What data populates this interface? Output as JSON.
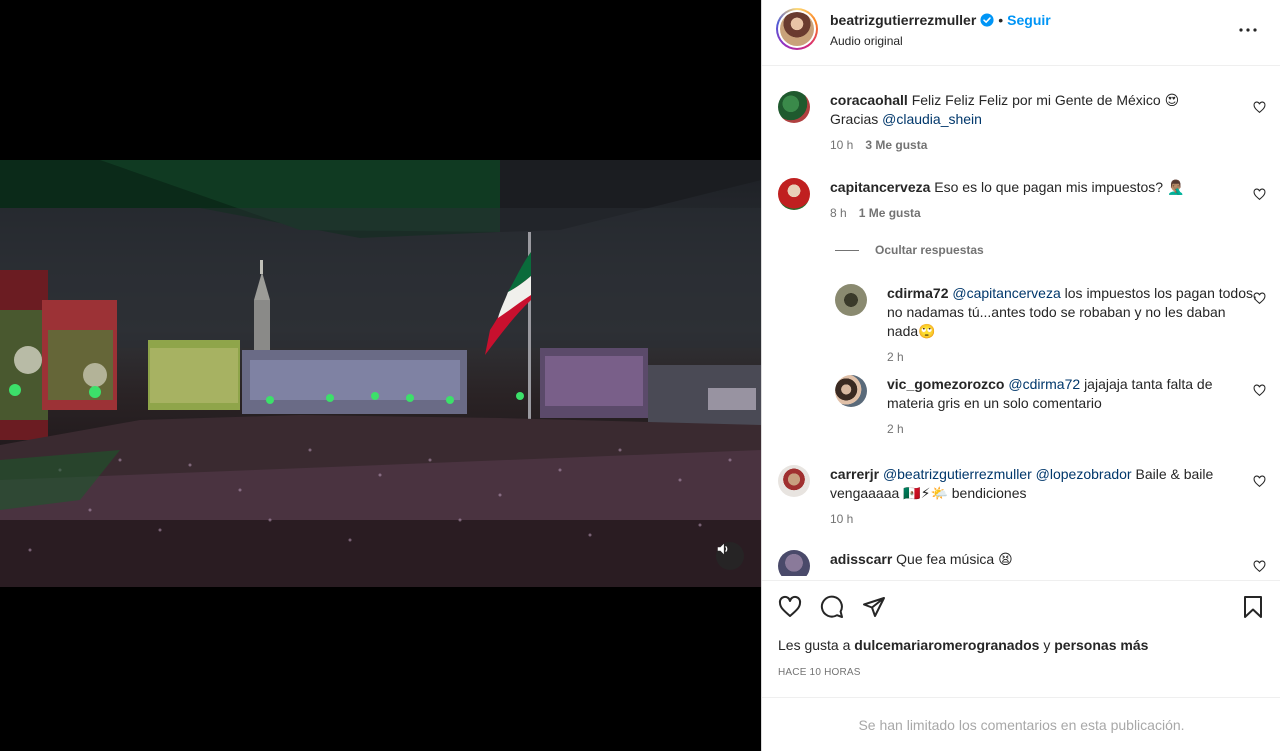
{
  "post": {
    "username": "beatrizgutierrezmuller",
    "follow_label": "Seguir",
    "audio_label": "Audio original",
    "separator": "•"
  },
  "comments": [
    {
      "user": "coracaohall",
      "text": "Feliz Feliz Feliz por mi Gente de México 😍 Gracias",
      "mention": "@claudia_shein",
      "time": "10 h",
      "likes": "3 Me gusta"
    },
    {
      "user": "capitancerveza",
      "text": "Eso es lo que pagan mis impuestos? 🤦🏽‍♂️",
      "time": "8 h",
      "likes": "1 Me gusta",
      "hide_replies_label": "Ocultar respuestas",
      "replies": [
        {
          "user": "cdirma72",
          "mention": "@capitancerveza",
          "text": "los impuestos los pagan todos, no nadamas tú...antes todo se robaban y no les daban nada🙄",
          "time": "2 h"
        },
        {
          "user": "vic_gomezorozco",
          "mention": "@cdirma72",
          "text": "jajajaja tanta falta de materia gris en un solo comentario",
          "time": "2 h"
        }
      ]
    },
    {
      "user": "carrerjr",
      "mention1": "@beatrizgutierrezmuller",
      "mention2": "@lopezobrador",
      "text": "Baile & baile vengaaaaa 🇲🇽⚡🌤️ bendiciones",
      "time": "10 h"
    },
    {
      "user": "adisscarr",
      "text": "Que fea música 😫"
    }
  ],
  "actions": {
    "likes_prefix": "Les gusta a",
    "liker": "dulcemariaromerogranados",
    "likes_mid": "y",
    "likes_suffix": "personas más",
    "timestamp": "HACE 10 HORAS"
  },
  "footer": {
    "limited_text": "Se han limitado los comentarios en esta publicación."
  },
  "icons": {
    "verified": "verified-badge-icon",
    "more": "more-options-icon",
    "heart": "heart-icon",
    "comment": "comment-icon",
    "share": "share-icon",
    "save": "bookmark-icon",
    "mute": "speaker-icon"
  },
  "colors": {
    "accent": "#0095f6",
    "mention": "#00376b",
    "muted": "#737373",
    "flag_green": "#0a6b3b",
    "flag_red": "#c8102e"
  }
}
